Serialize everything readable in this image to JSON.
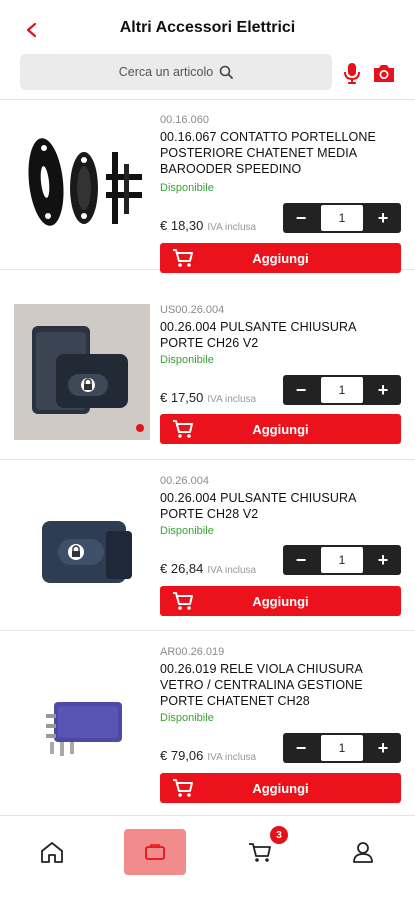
{
  "header": {
    "title": "Altri Accessori Elettrici",
    "search_placeholder": "Cerca un articolo"
  },
  "colors": {
    "accent": "#eb121c",
    "available": "#3aa335",
    "qty_bg": "#222222"
  },
  "products": [
    {
      "code": "00.16.060",
      "name": "00.16.067 CONTATTO PORTELLONE POSTERIORE CHATENET MEDIA BAROODER SPEEDINO",
      "availability": "Disponibile",
      "price": "€ 18,30",
      "vat": "IVA inclusa",
      "quantity": "1",
      "add_label": "Aggiungi"
    },
    {
      "code": "US00.26.004",
      "name": "00.26.004 PULSANTE CHIUSURA PORTE CH26 V2",
      "availability": "Disponibile",
      "price": "€ 17,50",
      "vat": "IVA inclusa",
      "quantity": "1",
      "add_label": "Aggiungi"
    },
    {
      "code": "00.26.004",
      "name": "00.26.004 PULSANTE CHIUSURA PORTE CH28 V2",
      "availability": "Disponibile",
      "price": "€ 26,84",
      "vat": "IVA inclusa",
      "quantity": "1",
      "add_label": "Aggiungi"
    },
    {
      "code": "AR00.26.019",
      "name": "00.26.019 RELE VIOLA CHIUSURA VETRO / CENTRALINA GESTIONE PORTE CHATENET CH28",
      "availability": "Disponibile",
      "price": "€ 79,06",
      "vat": "IVA inclusa",
      "quantity": "1",
      "add_label": "Aggiungi"
    }
  ],
  "tabbar": {
    "items": [
      {
        "icon": "home-icon"
      },
      {
        "icon": "catalog-icon"
      },
      {
        "icon": "cart-icon"
      },
      {
        "icon": "user-icon"
      }
    ],
    "cart_badge": "3"
  }
}
